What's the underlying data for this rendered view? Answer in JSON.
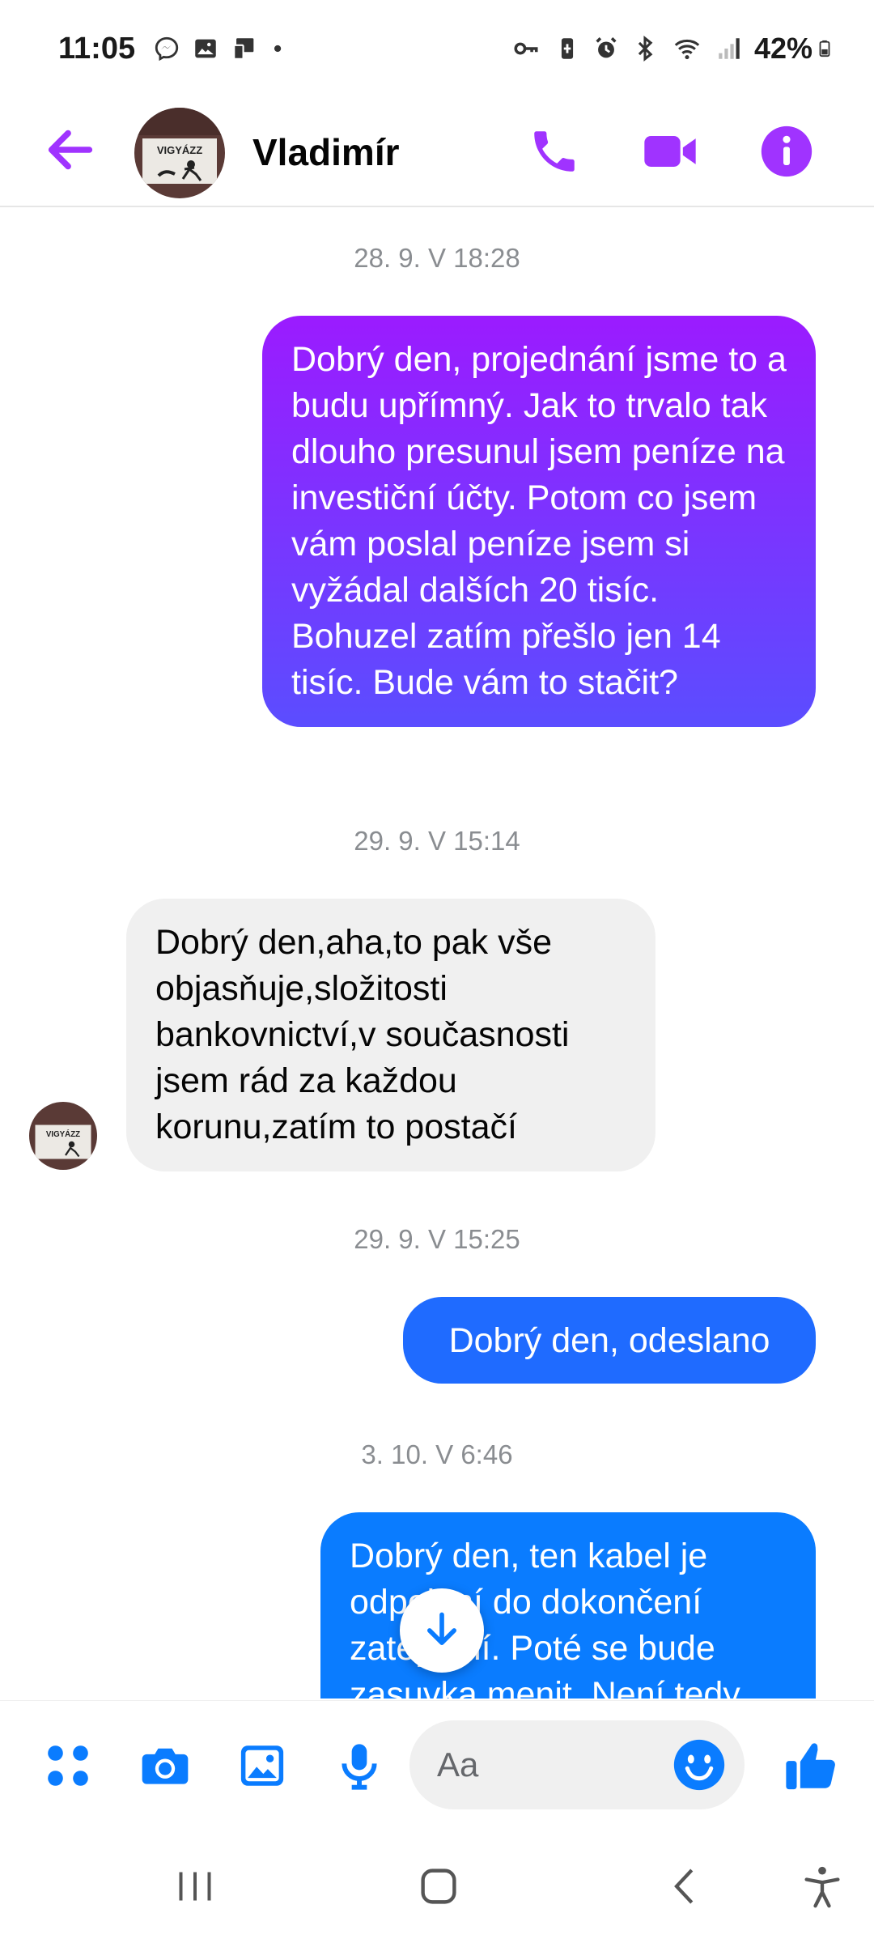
{
  "status_bar": {
    "time": "11:05",
    "battery": "42%",
    "left_icons": [
      "messenger-notification-icon",
      "gallery-notification-icon",
      "cast-icon",
      "dot-icon"
    ],
    "right_icons": [
      "vpn-key-icon",
      "battery-saver-icon",
      "alarm-icon",
      "bluetooth-icon",
      "wifi-icon",
      "signal-icon",
      "battery-icon"
    ]
  },
  "header": {
    "contact_name": "Vladimír",
    "avatar_label": "VIGYÁZZ",
    "icons": [
      "back-arrow-icon",
      "phone-icon",
      "video-camera-icon",
      "info-icon"
    ]
  },
  "conversation": {
    "timestamps": [
      "28. 9. V 18:28",
      "29. 9. V 15:14",
      "29. 9. V 15:25",
      "3. 10. V 6:46"
    ],
    "messages": [
      {
        "direction": "outgoing",
        "text": "Dobrý den,  projednání jsme to a budu upřímný.  Jak to trvalo tak dlouho presunul jsem peníze na investiční účty. Potom co jsem vám poslal peníze jsem si vyžádal dalších 20 tisíc. Bohuzel zatím přešlo jen 14 tisíc. Bude vám to stačit?"
      },
      {
        "direction": "incoming",
        "text": "Dobrý den,aha,to pak vše objasňuje,složitosti bankovnictví,v současnosti jsem rád za každou korunu,zatím to postačí"
      },
      {
        "direction": "outgoing",
        "text": "Dobrý den, odeslano"
      },
      {
        "direction": "outgoing",
        "text": "Dobrý den,  ten kabel je odpojení do dokončení zateplení.  Poté se bude zasuvka menit. Není tedy"
      }
    ]
  },
  "composer": {
    "placeholder": "Aa",
    "icons": [
      "apps-grid-icon",
      "camera-icon",
      "gallery-icon",
      "microphone-icon",
      "emoji-icon",
      "thumbs-up-icon"
    ]
  },
  "navbar": {
    "icons": [
      "recent-apps-icon",
      "home-icon",
      "back-icon",
      "accessibility-icon"
    ]
  },
  "colors": {
    "accent_purple": "#a033ff",
    "bubble_gradient_top": "#9b1bff",
    "bubble_gradient_bottom": "#5b4dff",
    "bubble_blue": "#1f6bff",
    "bubble_blue_light": "#0a7cff",
    "incoming_bubble": "#f0f0f0",
    "composer_blue": "#0a7cff"
  }
}
